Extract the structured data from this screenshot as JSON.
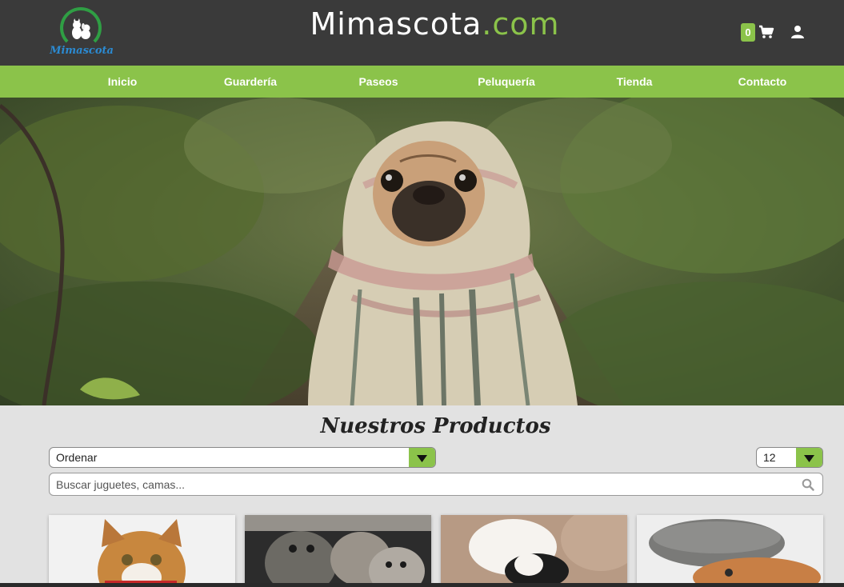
{
  "header": {
    "logo_text": "Mimascota",
    "brand_main": "Mimascota",
    "brand_tld": ".com",
    "cart_count": "0"
  },
  "nav": {
    "items": [
      {
        "label": "Inicio"
      },
      {
        "label": "Guardería"
      },
      {
        "label": "Paseos"
      },
      {
        "label": "Peluquería"
      },
      {
        "label": "Tienda"
      },
      {
        "label": "Contacto"
      }
    ]
  },
  "products": {
    "title": "Nuestros Productos",
    "sort_value": "Ordenar",
    "per_page_value": "12",
    "search_placeholder": "Buscar juguetes, camas..."
  },
  "colors": {
    "header_bg": "#3a3a3a",
    "accent": "#8bc34a",
    "logo_blue": "#2b8ad1",
    "page_bg": "#e2e2e2"
  }
}
